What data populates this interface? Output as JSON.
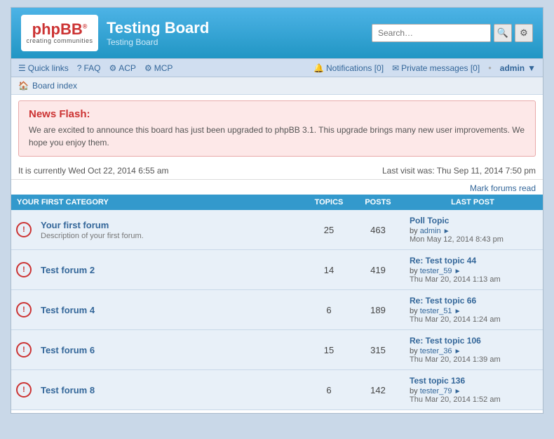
{
  "header": {
    "logo_text": "php",
    "logo_bold": "BB",
    "logo_reg": "®",
    "logo_sub": "creating communities",
    "board_title": "Testing Board",
    "board_desc": "Testing Board",
    "search_placeholder": "Search…"
  },
  "nav": {
    "quick_links": "Quick links",
    "faq": "FAQ",
    "acp": "ACP",
    "mcp": "MCP",
    "notifications": "Notifications",
    "notifications_count": "0",
    "private_messages": "Private messages",
    "pm_count": "0",
    "bullet": "•",
    "user": "admin",
    "user_arrow": "▼"
  },
  "breadcrumb": {
    "home_label": "Board index"
  },
  "news_flash": {
    "title": "News Flash:",
    "text": "We are excited to announce this board has just been upgraded to phpBB 3.1. This upgrade brings many new user improvements. We hope you enjoy them."
  },
  "info_bar": {
    "current_time": "It is currently Wed Oct 22, 2014 6:55 am",
    "last_visit": "Last visit was: Thu Sep 11, 2014 7:50 pm"
  },
  "mark_forums": "Mark forums read",
  "category": {
    "name": "YOUR FIRST CATEGORY",
    "col_topics": "TOPICS",
    "col_posts": "POSTS",
    "col_lastpost": "LAST POST"
  },
  "forums": [
    {
      "name": "Your first forum",
      "desc": "Description of your first forum.",
      "topics": "25",
      "posts": "463",
      "lastpost_title": "Poll Topic",
      "lastpost_by": "admin",
      "lastpost_date": "Mon May 12, 2014 8:43 pm"
    },
    {
      "name": "Test forum 2",
      "desc": "",
      "topics": "14",
      "posts": "419",
      "lastpost_title": "Re: Test topic 44",
      "lastpost_by": "tester_59",
      "lastpost_date": "Thu Mar 20, 2014 1:13 am"
    },
    {
      "name": "Test forum 4",
      "desc": "",
      "topics": "6",
      "posts": "189",
      "lastpost_title": "Re: Test topic 66",
      "lastpost_by": "tester_51",
      "lastpost_date": "Thu Mar 20, 2014 1:24 am"
    },
    {
      "name": "Test forum 6",
      "desc": "",
      "topics": "15",
      "posts": "315",
      "lastpost_title": "Re: Test topic 106",
      "lastpost_by": "tester_36",
      "lastpost_date": "Thu Mar 20, 2014 1:39 am"
    },
    {
      "name": "Test forum 8",
      "desc": "",
      "topics": "6",
      "posts": "142",
      "lastpost_title": "Test topic 136",
      "lastpost_by": "tester_79",
      "lastpost_date": "Thu Mar 20, 2014 1:52 am"
    }
  ]
}
